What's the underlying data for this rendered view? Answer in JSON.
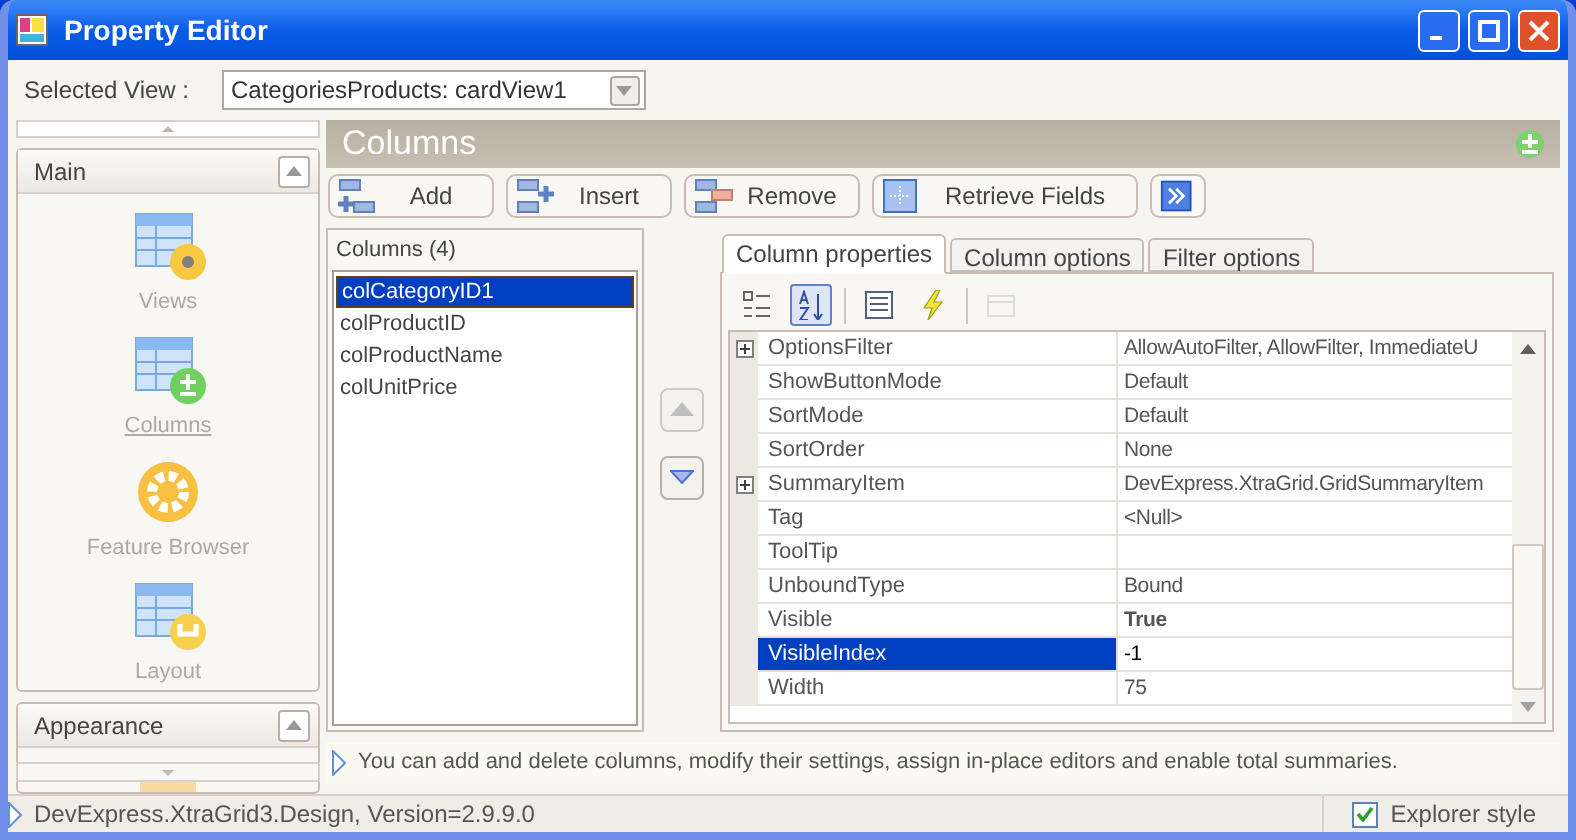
{
  "window": {
    "title": "Property Editor"
  },
  "selected_view": {
    "label": "Selected View :",
    "value": "CategoriesProducts: cardView1"
  },
  "sidebar": {
    "groups": [
      {
        "title": "Main",
        "expanded": true,
        "items": [
          {
            "label": "Views",
            "selected": false
          },
          {
            "label": "Columns",
            "selected": true
          },
          {
            "label": "Feature Browser",
            "selected": false
          },
          {
            "label": "Layout",
            "selected": false
          }
        ]
      },
      {
        "title": "Appearance",
        "expanded": true
      }
    ]
  },
  "panel": {
    "title": "Columns"
  },
  "toolbar": [
    {
      "label": "Add"
    },
    {
      "label": "Insert"
    },
    {
      "label": "Remove"
    },
    {
      "label": "Retrieve Fields"
    }
  ],
  "columns_list": {
    "title": "Columns (4)",
    "items": [
      {
        "label": "colCategoryID1",
        "selected": true
      },
      {
        "label": "colProductID",
        "selected": false
      },
      {
        "label": "colProductName",
        "selected": false
      },
      {
        "label": "colUnitPrice",
        "selected": false
      }
    ]
  },
  "tabs": [
    {
      "label": "Column properties",
      "selected": true
    },
    {
      "label": "Column options",
      "selected": false
    },
    {
      "label": "Filter options",
      "selected": false
    }
  ],
  "grid_toolbar": [
    {
      "selected": false,
      "disabled": false
    },
    {
      "selected": true,
      "disabled": false
    },
    {
      "selected": false,
      "disabled": false
    },
    {
      "selected": false,
      "disabled": false
    },
    {
      "selected": false,
      "disabled": true
    }
  ],
  "properties": [
    {
      "name": "OptionsFilter",
      "value": "AllowAutoFilter, AllowFilter, ImmediateU",
      "expandable": true,
      "selected": false
    },
    {
      "name": "ShowButtonMode",
      "value": "Default",
      "selected": false
    },
    {
      "name": "SortMode",
      "value": "Default",
      "selected": false
    },
    {
      "name": "SortOrder",
      "value": "None",
      "selected": false
    },
    {
      "name": "SummaryItem",
      "value": "DevExpress.XtraGrid.GridSummaryItem",
      "expandable": true,
      "selected": false
    },
    {
      "name": "Tag",
      "value": "<Null>",
      "selected": false
    },
    {
      "name": "ToolTip",
      "selected": false
    },
    {
      "name": "UnboundType",
      "value": "Bound",
      "selected": false
    },
    {
      "name": "Visible",
      "value": "True",
      "modified": true,
      "selected": false
    },
    {
      "name": "VisibleIndex",
      "value": "-1",
      "selected": true
    },
    {
      "name": "Width",
      "value": "75",
      "selected": false
    }
  ],
  "hint": "You can add and delete columns, modify their settings, assign in-place editors and enable total summaries.",
  "status_bar": {
    "text": "DevExpress.XtraGrid3.Design, Version=2.9.9.0",
    "explorer_style": {
      "label": "Explorer style",
      "checked": true
    }
  }
}
